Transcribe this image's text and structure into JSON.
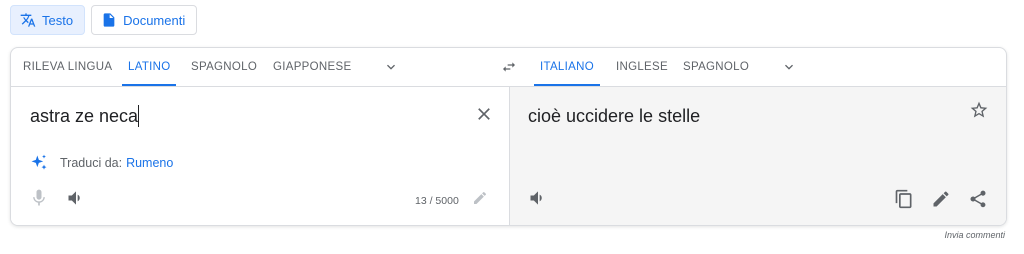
{
  "top_tabs": [
    {
      "label": "Testo",
      "icon": "translate-icon",
      "active": true
    },
    {
      "label": "Documenti",
      "icon": "document-icon",
      "active": false
    }
  ],
  "source_languages": [
    "RILEVA LINGUA",
    "LATINO",
    "SPAGNOLO",
    "GIAPPONESE"
  ],
  "source_active": "LATINO",
  "target_languages": [
    "ITALIANO",
    "INGLESE",
    "SPAGNOLO"
  ],
  "target_active": "ITALIANO",
  "source": {
    "text": "astra ze neca",
    "detect_prefix": "Traduci da:",
    "detect_language": "Rumeno",
    "char_count": "13 / 5000"
  },
  "target": {
    "text": "cioè uccidere le stelle"
  },
  "feedback_label": "Invia commenti",
  "colors": {
    "accent": "#1a73e8",
    "muted": "#5f6368",
    "target_bg": "#f5f5f5"
  }
}
